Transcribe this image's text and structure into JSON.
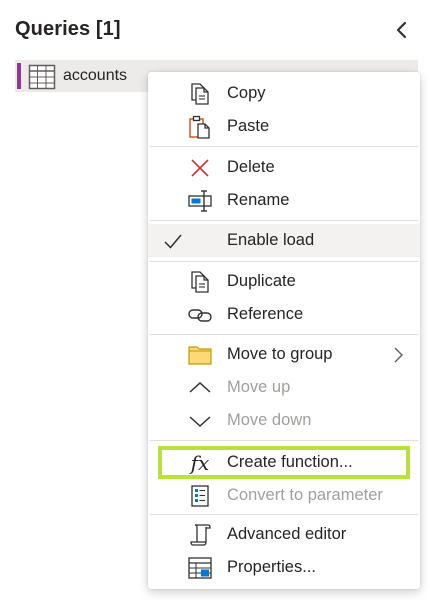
{
  "panel": {
    "title": "Queries [1]"
  },
  "queries": [
    {
      "name": "accounts",
      "icon": "table-icon"
    }
  ],
  "colors": {
    "accent": "#8a3a8f",
    "highlight": "#b6e23a",
    "icon_blue": "#0078d4",
    "icon_orange": "#ca5010",
    "icon_red": "#d13438",
    "folder": "#ffd876"
  },
  "menu": {
    "copy": {
      "label": "Copy",
      "icon": "copy-icon"
    },
    "paste": {
      "label": "Paste",
      "icon": "paste-icon"
    },
    "delete": {
      "label": "Delete",
      "icon": "delete-icon"
    },
    "rename": {
      "label": "Rename",
      "icon": "rename-icon"
    },
    "enable_load": {
      "label": "Enable load",
      "checked": true
    },
    "duplicate": {
      "label": "Duplicate",
      "icon": "duplicate-icon"
    },
    "reference": {
      "label": "Reference",
      "icon": "link-icon"
    },
    "move_to_group": {
      "label": "Move to group",
      "icon": "folder-icon",
      "has_submenu": true
    },
    "move_up": {
      "label": "Move up",
      "icon": "chevron-up-icon",
      "disabled": true
    },
    "move_down": {
      "label": "Move down",
      "icon": "chevron-down-icon",
      "disabled": true
    },
    "create_function": {
      "label": "Create function...",
      "icon": "fx-icon",
      "icon_text": "fx",
      "highlighted": true
    },
    "convert_to_parameter": {
      "label": "Convert to parameter",
      "icon": "parameter-icon",
      "disabled": true
    },
    "advanced_editor": {
      "label": "Advanced editor",
      "icon": "scroll-icon"
    },
    "properties": {
      "label": "Properties...",
      "icon": "properties-icon"
    }
  }
}
